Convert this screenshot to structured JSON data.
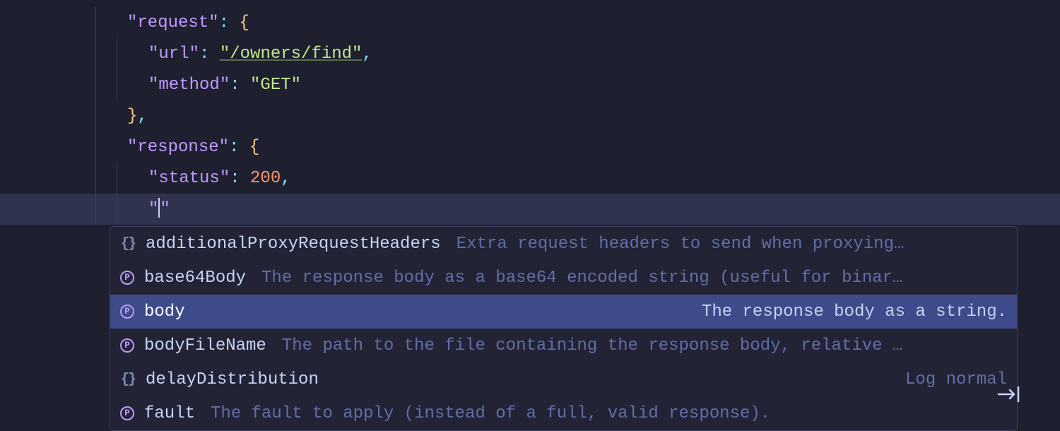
{
  "code": {
    "request_key": "\"request\"",
    "url_key": "\"url\"",
    "url_val": "\"/owners/find\"",
    "method_key": "\"method\"",
    "method_val": "\"GET\"",
    "response_key": "\"response\"",
    "status_key": "\"status\"",
    "status_val": "200",
    "empty_quote": "\"",
    "open_brace": "{",
    "close_brace": "}",
    "colon": ":",
    "comma": ","
  },
  "completion": {
    "selected_index": 2,
    "items": [
      {
        "icon": "braces",
        "label": "additionalProxyRequestHeaders",
        "desc": "Extra request headers to send when proxying…",
        "desc_align": "left"
      },
      {
        "icon": "prop",
        "label": "base64Body",
        "desc": "The response body as a base64 encoded string (useful for binar…",
        "desc_align": "left"
      },
      {
        "icon": "prop",
        "label": "body",
        "desc": "The response body as a string.",
        "desc_align": "right"
      },
      {
        "icon": "prop",
        "label": "bodyFileName",
        "desc": "The path to the file containing the response body, relative …",
        "desc_align": "left"
      },
      {
        "icon": "braces",
        "label": "delayDistribution",
        "desc": "Log normal",
        "desc_align": "right"
      },
      {
        "icon": "prop",
        "label": "fault",
        "desc": "The fault to apply (instead of a full, valid response).",
        "desc_align": "left"
      }
    ]
  }
}
